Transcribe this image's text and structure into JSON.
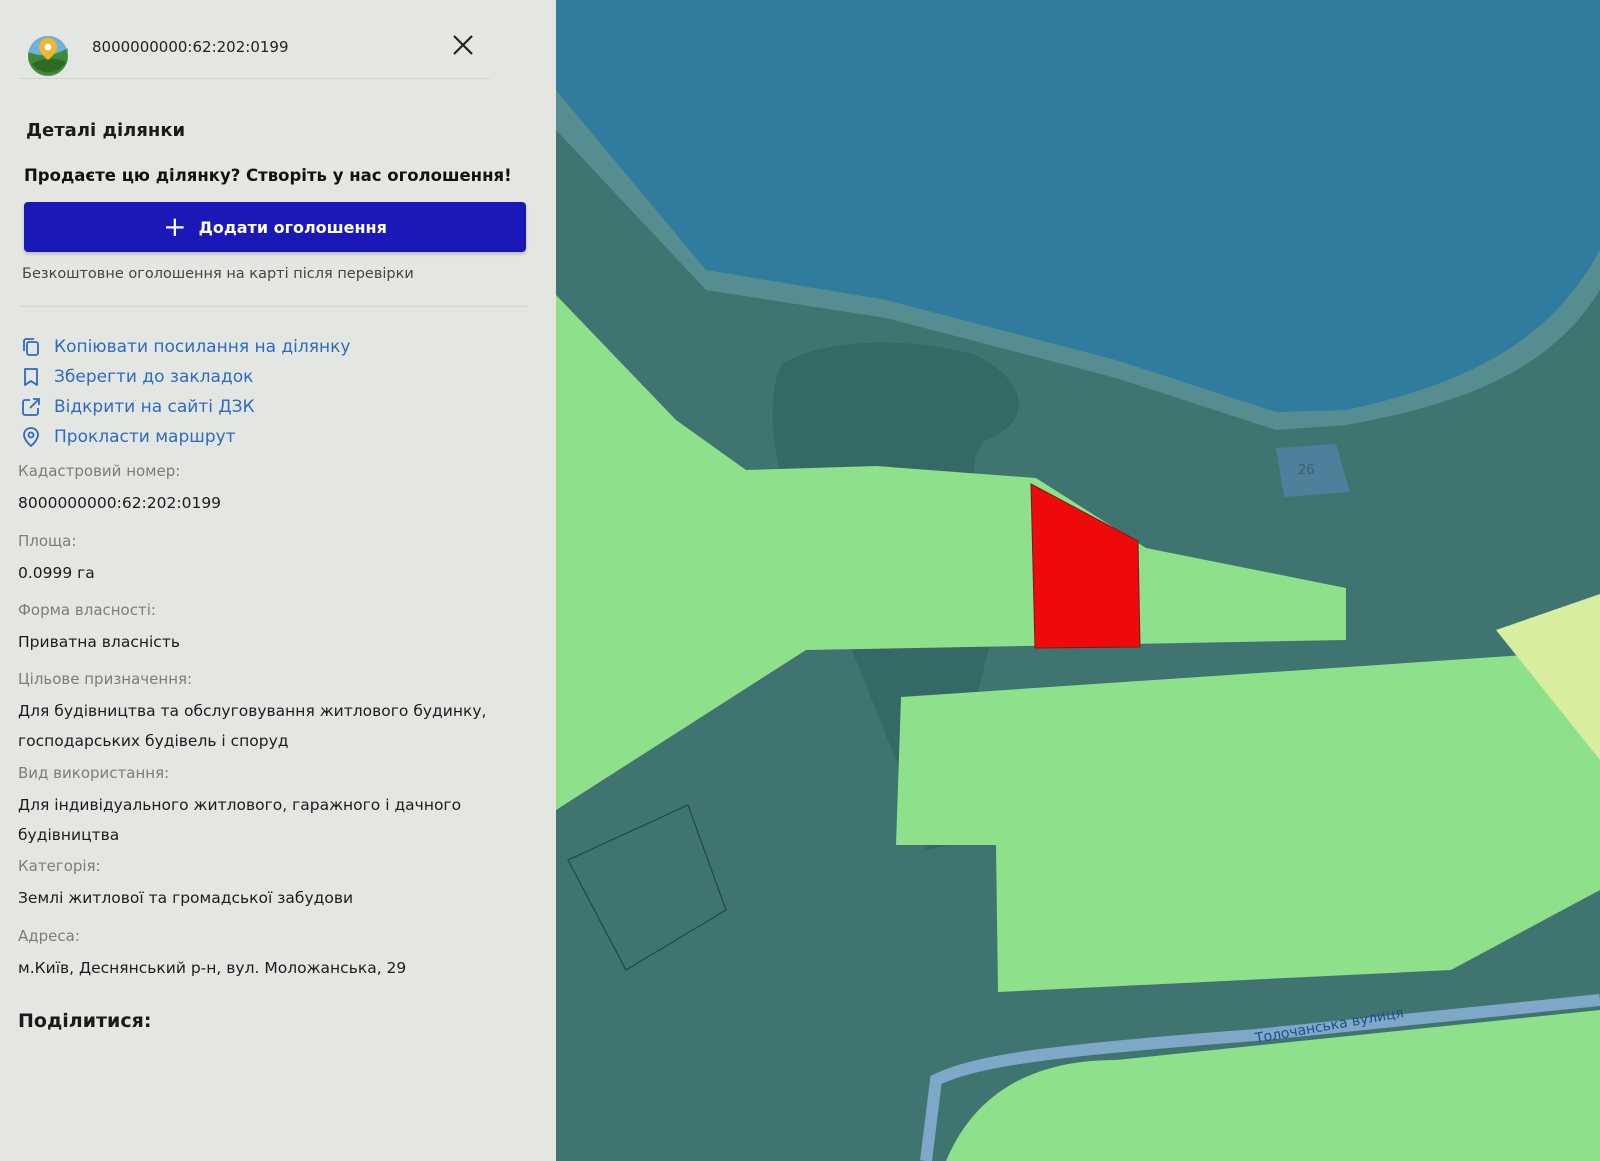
{
  "header": {
    "parcel_id": "8000000000:62:202:0199"
  },
  "details": {
    "title": "Деталі ділянки",
    "promo_text": "Продаєте цю ділянку? Створіть у нас оголошення!",
    "add_button_label": "Додати оголошення",
    "note": "Безкоштовне оголошення на карті після перевірки"
  },
  "actions": [
    {
      "label": "Копіювати посилання на ділянку",
      "icon": "copy-icon"
    },
    {
      "label": "Зберегти до закладок",
      "icon": "bookmark-icon"
    },
    {
      "label": "Відкрити на сайті ДЗК",
      "icon": "external-link-icon"
    },
    {
      "label": "Прокласти маршрут",
      "icon": "location-pin-icon"
    }
  ],
  "fields": {
    "cadastral": {
      "label": "Кадастровий номер:",
      "value": "8000000000:62:202:0199"
    },
    "area": {
      "label": "Площа:",
      "value": "0.0999 га"
    },
    "ownership": {
      "label": "Форма власності:",
      "value": "Приватна власність"
    },
    "purpose": {
      "label": "Цільове призначення:",
      "value": "Для будівництва та обслуговування житлового будинку, господарських будівель і споруд"
    },
    "usage": {
      "label": "Вид використання:",
      "value": "Для індивідуального житлового, гаражного і дачного будівництва"
    },
    "category": {
      "label": "Категорія:",
      "value": "Землі житлової та громадської забудови"
    },
    "address": {
      "label": "Адреса:",
      "value": "м.Київ, Деснянський р-н, вул. Моложанська, 29"
    }
  },
  "share_label": "Поділитися:",
  "map": {
    "street_label": "Толочанська вулиця",
    "parcel_number_label": "26",
    "colors": {
      "water": "#2f7c9e",
      "land": "#3f7470",
      "parcel": "#8ee08a",
      "selected": "#ee0a0a",
      "yellow_parcel": "#d8eda0"
    }
  }
}
